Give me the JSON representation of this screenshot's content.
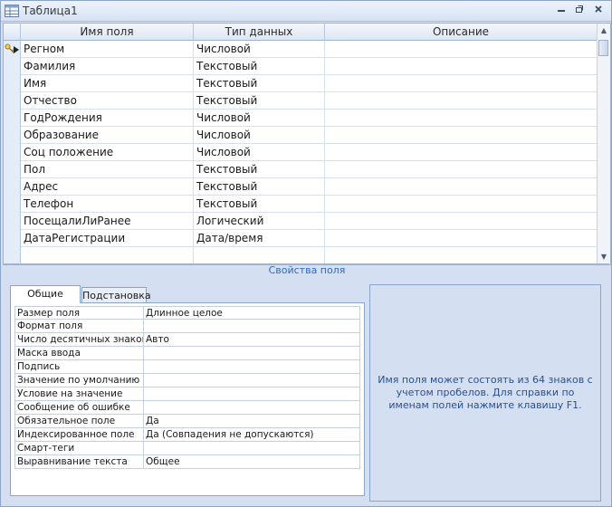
{
  "window": {
    "title": "Таблица1"
  },
  "grid": {
    "headers": [
      "Имя поля",
      "Тип данных",
      "Описание"
    ],
    "rows": [
      {
        "name": "Регном",
        "type": "Числовой",
        "desc": ""
      },
      {
        "name": "Фамилия",
        "type": "Текстовый",
        "desc": ""
      },
      {
        "name": "Имя",
        "type": "Текстовый",
        "desc": ""
      },
      {
        "name": "Отчество",
        "type": "Текстовый",
        "desc": ""
      },
      {
        "name": "ГодРождения",
        "type": "Числовой",
        "desc": ""
      },
      {
        "name": "Образование",
        "type": "Числовой",
        "desc": ""
      },
      {
        "name": "Соц положение",
        "type": "Числовой",
        "desc": ""
      },
      {
        "name": "Пол",
        "type": "Текстовый",
        "desc": ""
      },
      {
        "name": "Адрес",
        "type": "Текстовый",
        "desc": ""
      },
      {
        "name": "Телефон",
        "type": "Текстовый",
        "desc": ""
      },
      {
        "name": "ПосещалиЛиРанее",
        "type": "Логический",
        "desc": ""
      },
      {
        "name": "ДатаРегистрации",
        "type": "Дата/время",
        "desc": ""
      },
      {
        "name": "",
        "type": "",
        "desc": ""
      }
    ]
  },
  "properties": {
    "section_label": "Свойства поля",
    "tabs": [
      "Общие",
      "Подстановка"
    ],
    "items": [
      {
        "name": "Размер поля",
        "value": "Длинное целое"
      },
      {
        "name": "Формат поля",
        "value": ""
      },
      {
        "name": "Число десятичных знаков",
        "value": "Авто"
      },
      {
        "name": "Маска ввода",
        "value": ""
      },
      {
        "name": "Подпись",
        "value": ""
      },
      {
        "name": "Значение по умолчанию",
        "value": ""
      },
      {
        "name": "Условие на значение",
        "value": ""
      },
      {
        "name": "Сообщение об ошибке",
        "value": ""
      },
      {
        "name": "Обязательное поле",
        "value": "Да"
      },
      {
        "name": "Индексированное поле",
        "value": "Да (Совпадения не допускаются)"
      },
      {
        "name": "Смарт-теги",
        "value": ""
      },
      {
        "name": "Выравнивание текста",
        "value": "Общее"
      }
    ],
    "help_text": "Имя поля может состоять из 64 знаков с учетом пробелов.  Для справки по именам полей нажмите клавишу F1."
  },
  "colors": {
    "accent_text": "#3468b8",
    "help_text": "#2a4f91"
  },
  "icons": {
    "primary_key": "key-icon",
    "current_row": "arrow-right-icon"
  }
}
